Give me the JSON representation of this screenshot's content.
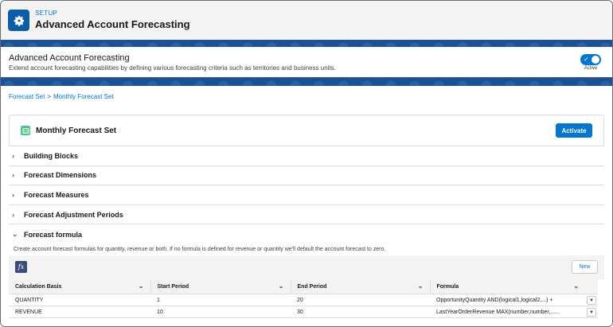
{
  "header": {
    "setup_label": "SETUP",
    "title": "Advanced Account Forecasting"
  },
  "feature": {
    "title": "Advanced Account Forecasting",
    "description": "Extend account forecasting capabilities by defining various forecasting criteria such as territories and business units.",
    "toggle_label": "Active",
    "toggle_on": true
  },
  "breadcrumb": {
    "items": [
      "Forecast Set",
      "Monthly Forecast Set"
    ],
    "separator": ">"
  },
  "forecast_set": {
    "title": "Monthly Forecast Set",
    "activate_label": "Activate"
  },
  "sections": [
    {
      "label": "Building Blocks",
      "expanded": false
    },
    {
      "label": "Forecast Dimensions",
      "expanded": false
    },
    {
      "label": "Forecast Measures",
      "expanded": false
    },
    {
      "label": "Forecast Adjustment Periods",
      "expanded": false
    },
    {
      "label": "Forecast formula",
      "expanded": true
    }
  ],
  "formula": {
    "description": "Create account forecast formulas for quantity, revenue or both. If no formula is defined for revenue or quantity we'll default the account forecast to zero.",
    "fx_label": "fx",
    "new_label": "New",
    "columns": [
      "Calculation Basis",
      "Start Period",
      "End Period",
      "Formula"
    ],
    "rows": [
      {
        "basis": "QUANTITY",
        "start": "1",
        "end": "20",
        "formula": "OpportunityQuantity AND(logical1,logical2,...) +"
      },
      {
        "basis": "REVENUE",
        "start": "10",
        "end": "30",
        "formula": "LastYearOrderRevenue MAX(number,number,......"
      }
    ]
  },
  "colors": {
    "brand_blue": "#0176d3",
    "band_blue": "#1b5297",
    "success_green": "#4bca81"
  }
}
